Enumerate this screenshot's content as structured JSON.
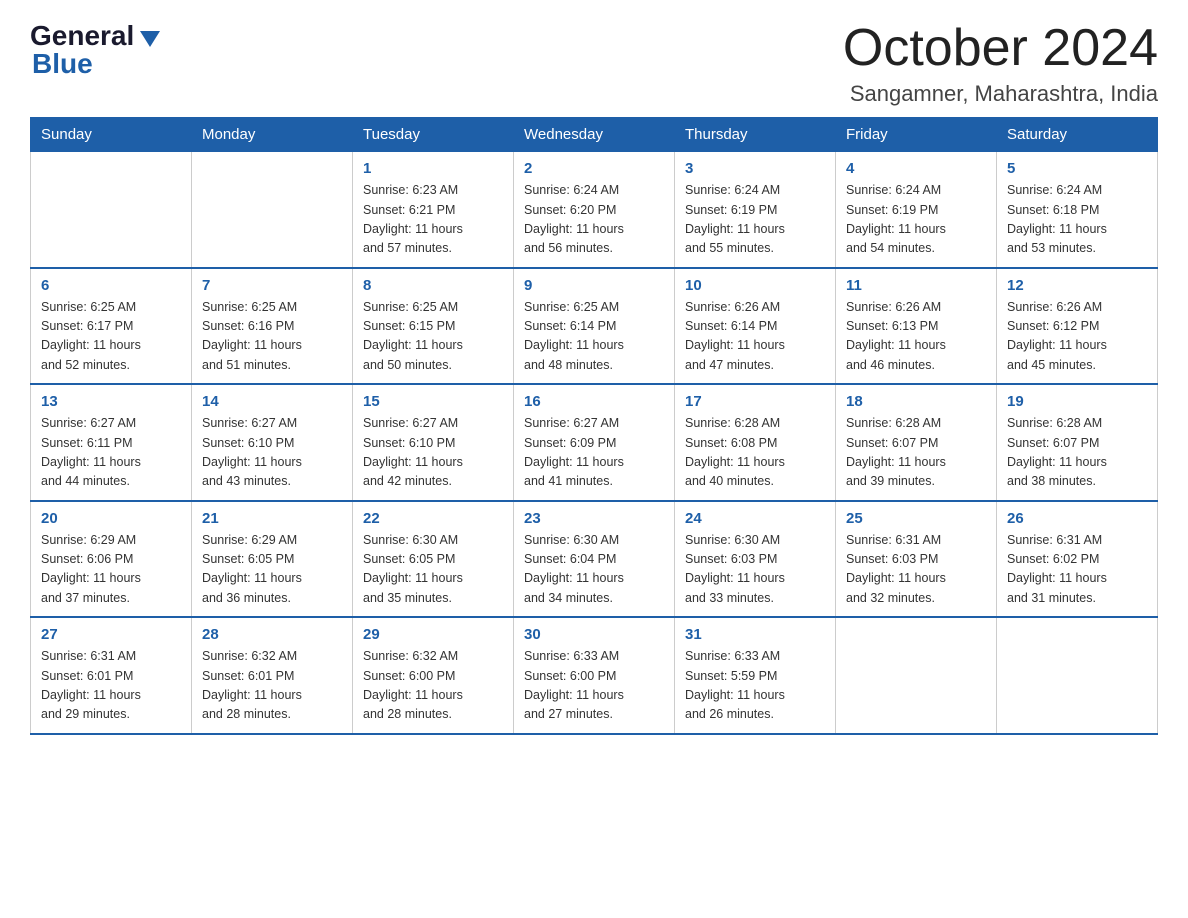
{
  "logo": {
    "general": "General",
    "blue": "Blue"
  },
  "title": "October 2024",
  "location": "Sangamner, Maharashtra, India",
  "days_header": [
    "Sunday",
    "Monday",
    "Tuesday",
    "Wednesday",
    "Thursday",
    "Friday",
    "Saturday"
  ],
  "weeks": [
    [
      {
        "day": "",
        "info": ""
      },
      {
        "day": "",
        "info": ""
      },
      {
        "day": "1",
        "info": "Sunrise: 6:23 AM\nSunset: 6:21 PM\nDaylight: 11 hours\nand 57 minutes."
      },
      {
        "day": "2",
        "info": "Sunrise: 6:24 AM\nSunset: 6:20 PM\nDaylight: 11 hours\nand 56 minutes."
      },
      {
        "day": "3",
        "info": "Sunrise: 6:24 AM\nSunset: 6:19 PM\nDaylight: 11 hours\nand 55 minutes."
      },
      {
        "day": "4",
        "info": "Sunrise: 6:24 AM\nSunset: 6:19 PM\nDaylight: 11 hours\nand 54 minutes."
      },
      {
        "day": "5",
        "info": "Sunrise: 6:24 AM\nSunset: 6:18 PM\nDaylight: 11 hours\nand 53 minutes."
      }
    ],
    [
      {
        "day": "6",
        "info": "Sunrise: 6:25 AM\nSunset: 6:17 PM\nDaylight: 11 hours\nand 52 minutes."
      },
      {
        "day": "7",
        "info": "Sunrise: 6:25 AM\nSunset: 6:16 PM\nDaylight: 11 hours\nand 51 minutes."
      },
      {
        "day": "8",
        "info": "Sunrise: 6:25 AM\nSunset: 6:15 PM\nDaylight: 11 hours\nand 50 minutes."
      },
      {
        "day": "9",
        "info": "Sunrise: 6:25 AM\nSunset: 6:14 PM\nDaylight: 11 hours\nand 48 minutes."
      },
      {
        "day": "10",
        "info": "Sunrise: 6:26 AM\nSunset: 6:14 PM\nDaylight: 11 hours\nand 47 minutes."
      },
      {
        "day": "11",
        "info": "Sunrise: 6:26 AM\nSunset: 6:13 PM\nDaylight: 11 hours\nand 46 minutes."
      },
      {
        "day": "12",
        "info": "Sunrise: 6:26 AM\nSunset: 6:12 PM\nDaylight: 11 hours\nand 45 minutes."
      }
    ],
    [
      {
        "day": "13",
        "info": "Sunrise: 6:27 AM\nSunset: 6:11 PM\nDaylight: 11 hours\nand 44 minutes."
      },
      {
        "day": "14",
        "info": "Sunrise: 6:27 AM\nSunset: 6:10 PM\nDaylight: 11 hours\nand 43 minutes."
      },
      {
        "day": "15",
        "info": "Sunrise: 6:27 AM\nSunset: 6:10 PM\nDaylight: 11 hours\nand 42 minutes."
      },
      {
        "day": "16",
        "info": "Sunrise: 6:27 AM\nSunset: 6:09 PM\nDaylight: 11 hours\nand 41 minutes."
      },
      {
        "day": "17",
        "info": "Sunrise: 6:28 AM\nSunset: 6:08 PM\nDaylight: 11 hours\nand 40 minutes."
      },
      {
        "day": "18",
        "info": "Sunrise: 6:28 AM\nSunset: 6:07 PM\nDaylight: 11 hours\nand 39 minutes."
      },
      {
        "day": "19",
        "info": "Sunrise: 6:28 AM\nSunset: 6:07 PM\nDaylight: 11 hours\nand 38 minutes."
      }
    ],
    [
      {
        "day": "20",
        "info": "Sunrise: 6:29 AM\nSunset: 6:06 PM\nDaylight: 11 hours\nand 37 minutes."
      },
      {
        "day": "21",
        "info": "Sunrise: 6:29 AM\nSunset: 6:05 PM\nDaylight: 11 hours\nand 36 minutes."
      },
      {
        "day": "22",
        "info": "Sunrise: 6:30 AM\nSunset: 6:05 PM\nDaylight: 11 hours\nand 35 minutes."
      },
      {
        "day": "23",
        "info": "Sunrise: 6:30 AM\nSunset: 6:04 PM\nDaylight: 11 hours\nand 34 minutes."
      },
      {
        "day": "24",
        "info": "Sunrise: 6:30 AM\nSunset: 6:03 PM\nDaylight: 11 hours\nand 33 minutes."
      },
      {
        "day": "25",
        "info": "Sunrise: 6:31 AM\nSunset: 6:03 PM\nDaylight: 11 hours\nand 32 minutes."
      },
      {
        "day": "26",
        "info": "Sunrise: 6:31 AM\nSunset: 6:02 PM\nDaylight: 11 hours\nand 31 minutes."
      }
    ],
    [
      {
        "day": "27",
        "info": "Sunrise: 6:31 AM\nSunset: 6:01 PM\nDaylight: 11 hours\nand 29 minutes."
      },
      {
        "day": "28",
        "info": "Sunrise: 6:32 AM\nSunset: 6:01 PM\nDaylight: 11 hours\nand 28 minutes."
      },
      {
        "day": "29",
        "info": "Sunrise: 6:32 AM\nSunset: 6:00 PM\nDaylight: 11 hours\nand 28 minutes."
      },
      {
        "day": "30",
        "info": "Sunrise: 6:33 AM\nSunset: 6:00 PM\nDaylight: 11 hours\nand 27 minutes."
      },
      {
        "day": "31",
        "info": "Sunrise: 6:33 AM\nSunset: 5:59 PM\nDaylight: 11 hours\nand 26 minutes."
      },
      {
        "day": "",
        "info": ""
      },
      {
        "day": "",
        "info": ""
      }
    ]
  ]
}
